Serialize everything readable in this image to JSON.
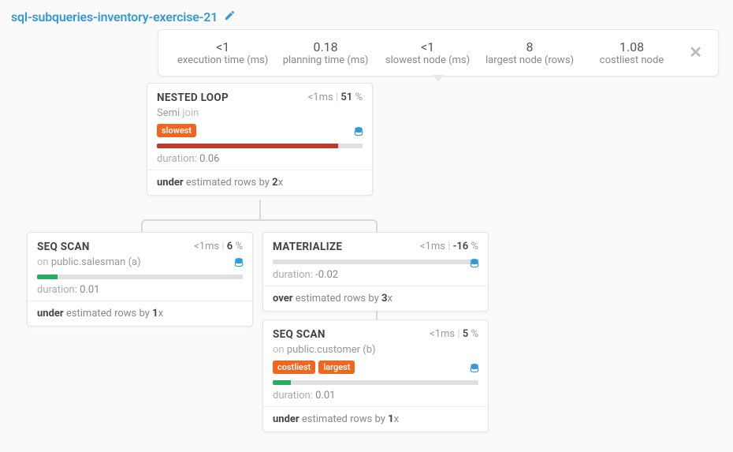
{
  "header": {
    "title": "sql-subqueries-inventory-exercise-21"
  },
  "stats": {
    "executionTime": {
      "value": "<1",
      "label": "execution time (ms)"
    },
    "planningTime": {
      "value": "0.18",
      "label": "planning time (ms)"
    },
    "slowestNode": {
      "value": "<1",
      "label": "slowest node (ms)"
    },
    "largestNode": {
      "value": "8",
      "label": "largest node (rows)"
    },
    "costliestNode": {
      "value": "1.08",
      "label": "costliest node"
    }
  },
  "nodes": {
    "nestedLoop": {
      "title": "NESTED LOOP",
      "timeUnit": "<1",
      "pct": "51",
      "sub1": "Semi",
      "sub2": "join",
      "badges": [
        "slowest"
      ],
      "barColor": "red",
      "barPct": 88,
      "duration": "0.06",
      "estDir": "under",
      "estX": "2"
    },
    "seqScanA": {
      "title": "SEQ SCAN",
      "timeUnit": "<1",
      "pct": "6",
      "on1": "on",
      "on2": "public.salesman (a)",
      "barColor": "green",
      "barPct": 10,
      "duration": "0.01",
      "estDir": "under",
      "estX": "1"
    },
    "materialize": {
      "title": "MATERIALIZE",
      "timeUnit": "<1",
      "pct": "-16",
      "barColor": "green",
      "barPct": 0,
      "duration": "-0.02",
      "estDir": "over",
      "estX": "3"
    },
    "seqScanB": {
      "title": "SEQ SCAN",
      "timeUnit": "<1",
      "pct": "5",
      "on1": "on",
      "on2": "public.customer (b)",
      "badges": [
        "costliest",
        "largest"
      ],
      "barColor": "green",
      "barPct": 9,
      "duration": "0.01",
      "estDir": "under",
      "estX": "1"
    }
  },
  "labels": {
    "durationLabel": "duration:",
    "estMid": "estimated rows by",
    "xSuffix": "x",
    "msText": "ms",
    "sep": "|",
    "pctSign": "%"
  }
}
